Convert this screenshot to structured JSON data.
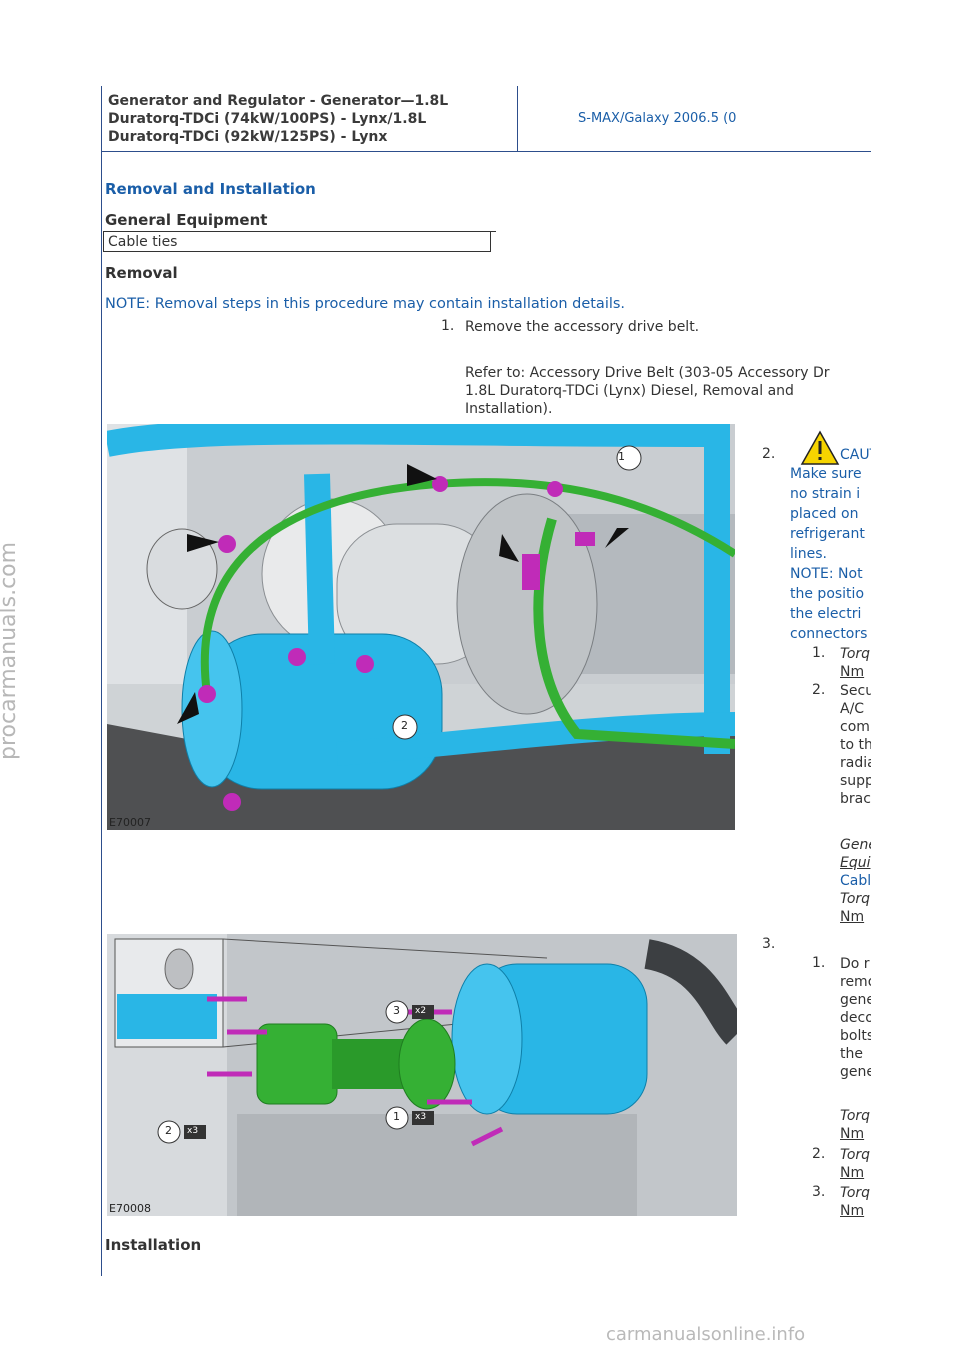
{
  "header": {
    "title_line1": "Generator and Regulator - Generator—1.8L",
    "title_line2": "Duratorq-TDCi (74kW/100PS) - Lynx/1.8L",
    "title_line3": "Duratorq-TDCi (92kW/125PS) - Lynx",
    "vehicle": "S-MAX/Galaxy 2006.5 (0"
  },
  "section_title": "Removal and Installation",
  "general_equipment": {
    "heading": "General Equipment",
    "items": [
      "Cable ties"
    ]
  },
  "removal": {
    "heading": "Removal",
    "note": "NOTE: Removal steps in this procedure may contain installation details.",
    "step1": {
      "number": "1.",
      "text": "Remove the accessory drive belt.",
      "ref_line1": "Refer to: Accessory Drive Belt (303-05 Accessory Dr",
      "ref_line2": "1.8L Duratorq-TDCi (Lynx) Diesel, Removal and",
      "ref_line3": "Installation)."
    },
    "step2": {
      "number": "2.",
      "caution_label": "CAUTI",
      "caution_lines": [
        "Make sure",
        "no strain i",
        "placed on",
        "refrigerant",
        "lines."
      ],
      "note_lines": [
        "NOTE: Not",
        "the positio",
        "the electri",
        "connectors"
      ],
      "sub1_number": "1.",
      "sub1_torque": "Torq",
      "sub1_nm": "Nm",
      "sub2_number": "2.",
      "sub2_lines": [
        "Secu",
        "A/C",
        "com",
        "to th",
        "radia",
        "supp",
        "brac"
      ],
      "gen_lines": [
        "Gene",
        "Equi"
      ],
      "cable": "Cabl",
      "torque": "Torq",
      "nm": "Nm",
      "figure_id": "E70007"
    },
    "step3": {
      "number": "3.",
      "sub1_number": "1.",
      "sub1_lines": [
        "Do r",
        "remo",
        "gene",
        "deco",
        "bolts",
        "the",
        "gene"
      ],
      "sub1_torque": "Torq",
      "sub1_nm": "Nm",
      "sub2_number": "2.",
      "sub2_torque": "Torq",
      "sub2_nm": "Nm",
      "sub3_number": "3.",
      "sub3_torque": "Torq",
      "sub3_nm": "Nm",
      "figure_id": "E70008",
      "callouts": [
        "1",
        "2",
        "3"
      ],
      "multipliers": [
        "x3",
        "x3",
        "x2"
      ]
    }
  },
  "installation_heading": "Installation",
  "watermarks": {
    "left": "procarmanuals.com",
    "bottom": "carmanualsonline.info"
  },
  "colors": {
    "heading_blue": "#1a5ea8",
    "rule_blue": "#2d4e8c",
    "component_blue": "#29b6e6",
    "component_green": "#35b034",
    "fastener_magenta": "#c02bb8"
  }
}
